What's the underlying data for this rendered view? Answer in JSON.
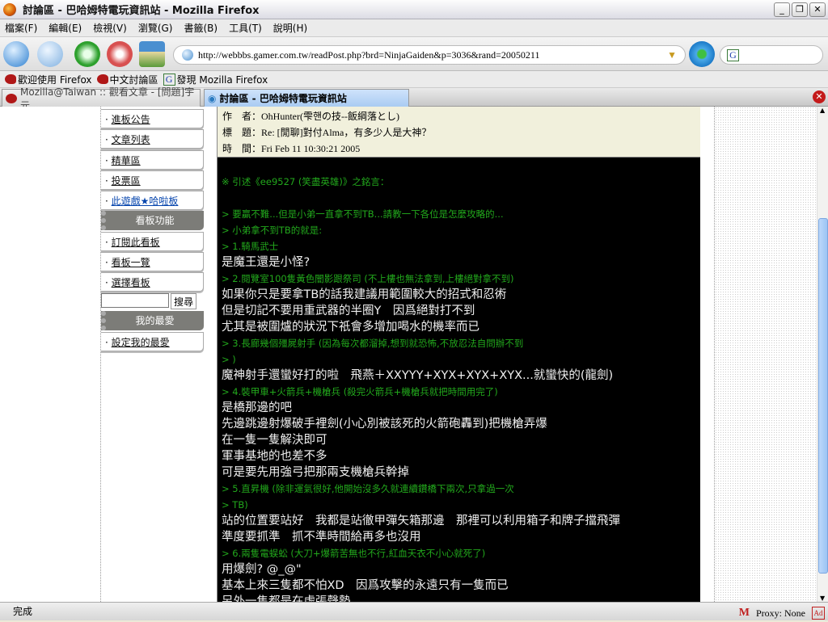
{
  "window": {
    "title": "討論區 - 巴哈姆特電玩資訊站 - Mozilla Firefox"
  },
  "menu": [
    "檔案(F)",
    "編輯(E)",
    "檢視(V)",
    "瀏覽(G)",
    "書籤(B)",
    "工具(T)",
    "說明(H)"
  ],
  "url": "http://webbbs.gamer.com.tw/readPost.php?brd=NinjaGaiden&p=3036&rand=20050211",
  "bookmarks": [
    "歡迎使用 Firefox",
    "中文討論區",
    "發現 Mozilla Firefox"
  ],
  "tabs": [
    "Mozilla@Taiwan :: 觀看文章 - [問題]宇元...",
    "討論區 - 巴哈姆特電玩資訊站"
  ],
  "sidebar": {
    "items": [
      "進板公告",
      "文章列表",
      "精華區",
      "投票區",
      "此遊戲★哈啦板"
    ],
    "head1": "看板功能",
    "items2": [
      "訂閱此看板",
      "看板一覽",
      "選擇看板"
    ],
    "search_btn": "搜尋",
    "head2": "我的最愛",
    "items3": [
      "設定我的最愛"
    ]
  },
  "post": {
    "author": "作　者：OhHunter(雫핸の技--飯綱落とし)",
    "subject": "標　題：Re: [閒聊]對付Alma，有多少人是大神？",
    "time": "時　間：Fri Feb 11 10:30:21 2005",
    "lines": [
      {
        "t": "※ 引述《ee9527 (笑盡英雄)》之銘言：",
        "c": "g"
      },
      {
        "t": "",
        "c": "g"
      },
      {
        "t": "> 要贏不難...但是小弟一直拿不到TB...請教一下各位是怎麼攻略的...",
        "c": "g"
      },
      {
        "t": "> 小弟拿不到TB的就是:",
        "c": "g"
      },
      {
        "t": "> 1.騎馬武士",
        "c": "g"
      },
      {
        "t": "是魔王還是小怪?",
        "c": "w"
      },
      {
        "t": "> 2.閱覽室100隻黃色闇影跟祭司 (不上樓也無法拿到,上樓絕對拿不到)",
        "c": "g"
      },
      {
        "t": "如果你只是要拿TB的話我建議用範圍較大的招式和忍術",
        "c": "w"
      },
      {
        "t": "但是切記不要用重武器的半圈Y　因爲絕對打不到",
        "c": "w"
      },
      {
        "t": "尤其是被圍爐的狀況下祇會多增加喝水的機率而已",
        "c": "w"
      },
      {
        "t": "> 3.長廊幾個殭屍射手 (因為每次都溜掉,想到就恐怖,不放忍法自問辦不到",
        "c": "g"
      },
      {
        "t": "> )",
        "c": "g"
      },
      {
        "t": "魔神射手還蠻好打的啦　飛燕＋XXYYY+XYX+XYX+XYX...就蠻快的(龍劍)",
        "c": "w"
      },
      {
        "t": "> 4.裝甲車+火箭兵+機槍兵 (殺完火箭兵+機槍兵就把時間用完了)",
        "c": "g"
      },
      {
        "t": "是橋那邊的吧",
        "c": "w"
      },
      {
        "t": "先邊跳邊射爆破手裡劍(小心別被該死的火箭砲轟到)把機槍弄爆",
        "c": "w"
      },
      {
        "t": "在一隻一隻解決即可",
        "c": "w"
      },
      {
        "t": "軍事基地的也差不多",
        "c": "w"
      },
      {
        "t": "可是要先用強弓把那兩支機槍兵幹掉",
        "c": "w"
      },
      {
        "t": "> 5.直昇機 (除非運氣很好,他開始沒多久就連續鑽橋下兩次,只拿過一次",
        "c": "g"
      },
      {
        "t": "> TB)",
        "c": "g"
      },
      {
        "t": "站的位置要站好　我都是站徹甲彈矢箱那邊　那裡可以利用箱子和牌子擋飛彈",
        "c": "w"
      },
      {
        "t": "準度要抓準　抓不準時間給再多也沒用",
        "c": "w"
      },
      {
        "t": "> 6.兩隻電蜈蚣 (大刀+爆箭苦無也不行,紅血天衣不小心就死了)",
        "c": "g"
      },
      {
        "t": "用爆劍? @_@\"",
        "c": "w"
      },
      {
        "t": "基本上來三隻都不怕XD　因爲攻擊的永遠只有一隻而已",
        "c": "w"
      },
      {
        "t": "另外一隻都是在虛張聲勢",
        "c": "w"
      }
    ]
  },
  "status": {
    "text": "完成",
    "proxy": "Proxy: None"
  }
}
